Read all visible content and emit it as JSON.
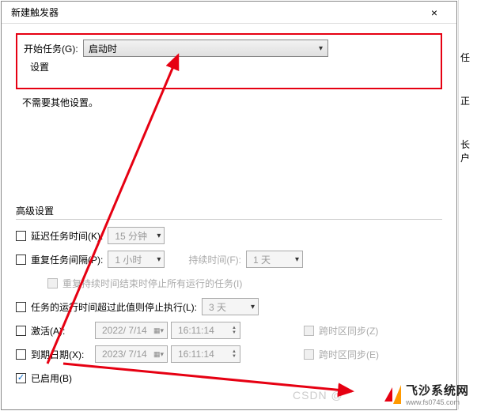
{
  "titlebar": {
    "title": "新建触发器",
    "close": "×"
  },
  "main": {
    "begin_task_label": "开始任务(G):",
    "begin_task_value": "启动时",
    "settings_label": "设置",
    "info_text": "不需要其他设置。"
  },
  "advanced": {
    "section_title": "高级设置",
    "delay_label": "延迟任务时间(K):",
    "delay_value": "15 分钟",
    "repeat_label": "重复任务间隔(P):",
    "repeat_value": "1 小时",
    "duration_label": "持续时间(F):",
    "duration_value": "1 天",
    "stop_all_label": "重复持续时间结束时停止所有运行的任务(I)",
    "stop_after_label": "任务的运行时间超过此值则停止执行(L):",
    "stop_after_value": "3 天",
    "activate_label": "激活(A):",
    "activate_date": "2022/ 7/14",
    "activate_time": "16:11:14",
    "tz_sync1": "跨时区同步(Z)",
    "expire_label": "到期日期(X):",
    "expire_date": "2023/ 7/14",
    "expire_time": "16:11:14",
    "tz_sync2": "跨时区同步(E)",
    "enabled_label": "已启用(B)"
  },
  "sidebar": {
    "items": [
      "任",
      "正",
      "长户"
    ]
  },
  "watermark": {
    "csdn": "CSDN @",
    "brand": "飞沙系统网",
    "url": "www.fs0745.com"
  }
}
